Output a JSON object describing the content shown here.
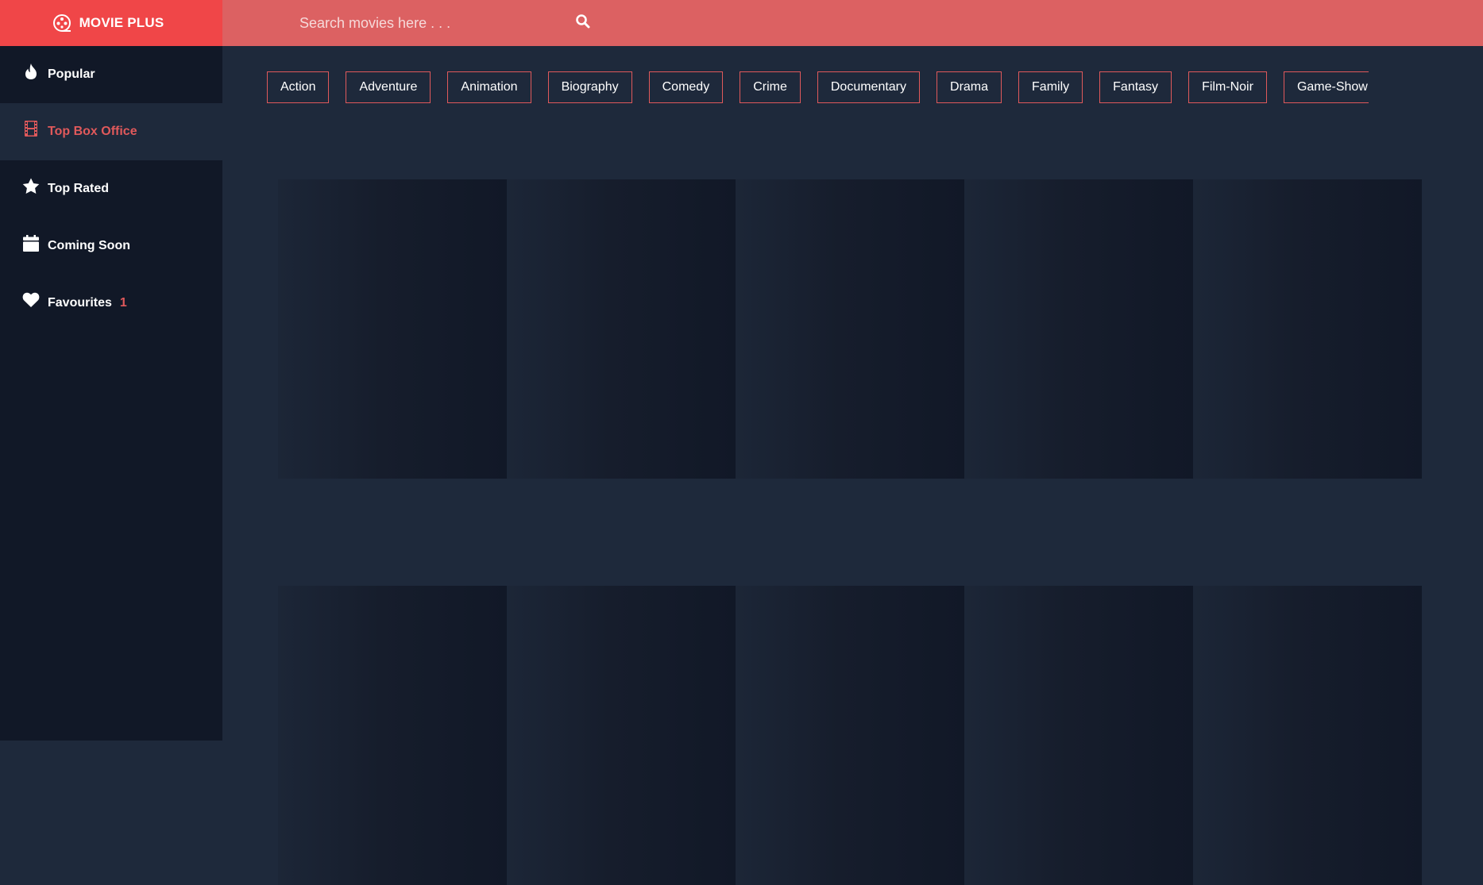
{
  "brand": {
    "name": "MOVIE PLUS",
    "icon": "film-reel-icon"
  },
  "search": {
    "placeholder": "Search movies here . . .",
    "value": ""
  },
  "sidebar": {
    "items": [
      {
        "label": "Popular",
        "icon": "flame-icon",
        "active": false
      },
      {
        "label": "Top Box Office",
        "icon": "film-strip-icon",
        "active": true
      },
      {
        "label": "Top Rated",
        "icon": "star-icon",
        "active": false
      },
      {
        "label": "Coming Soon",
        "icon": "calendar-icon",
        "active": false
      },
      {
        "label": "Favourites",
        "icon": "heart-icon",
        "active": false,
        "count": "1"
      }
    ]
  },
  "genres": [
    "Action",
    "Adventure",
    "Animation",
    "Biography",
    "Comedy",
    "Crime",
    "Documentary",
    "Drama",
    "Family",
    "Fantasy",
    "Film-Noir",
    "Game-Show"
  ],
  "colors": {
    "accent": "#e0595b",
    "brand_bg": "#f04648",
    "header_bg": "#dc6162",
    "sidebar_bg": "#111827",
    "content_bg": "#1e293b"
  }
}
